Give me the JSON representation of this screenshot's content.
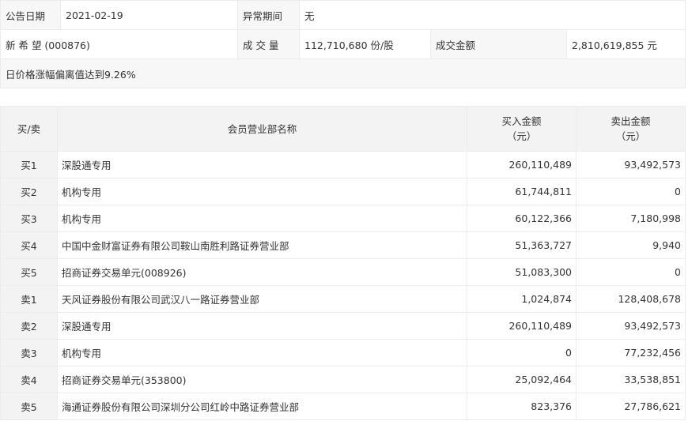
{
  "info": {
    "date_label": "公告日期",
    "date_value": "2021-02-19",
    "period_label": "异常期间",
    "period_value": "无",
    "stock": "新 希 望 (000876)",
    "volume_label": "成 交 量",
    "volume_value": "112,710,680 份/股",
    "amount_label": "成交金额",
    "amount_value": "2,810,619,855 元",
    "reason": "日价格涨幅偏离值达到9.26%"
  },
  "table": {
    "headers": {
      "side": "买/卖",
      "dept": "会员营业部名称",
      "buy_line1": "买入金额",
      "buy_line2": "（元）",
      "sell_line1": "卖出金额",
      "sell_line2": "（元）"
    },
    "rows": [
      {
        "side": "买1",
        "name": "深股通专用",
        "buy": "260,110,489",
        "sell": "93,492,573"
      },
      {
        "side": "买2",
        "name": "机构专用",
        "buy": "61,744,811",
        "sell": "0"
      },
      {
        "side": "买3",
        "name": "机构专用",
        "buy": "60,122,366",
        "sell": "7,180,998"
      },
      {
        "side": "买4",
        "name": "中国中金财富证券有限公司鞍山南胜利路证券营业部",
        "buy": "51,363,727",
        "sell": "9,940"
      },
      {
        "side": "买5",
        "name": "招商证券交易单元(008926)",
        "buy": "51,083,300",
        "sell": "0"
      },
      {
        "side": "卖1",
        "name": "天风证券股份有限公司武汉八一路证券营业部",
        "buy": "1,024,874",
        "sell": "128,408,678"
      },
      {
        "side": "卖2",
        "name": "深股通专用",
        "buy": "260,110,489",
        "sell": "93,492,573"
      },
      {
        "side": "卖3",
        "name": "机构专用",
        "buy": "0",
        "sell": "77,232,456"
      },
      {
        "side": "卖4",
        "name": "招商证券交易单元(353800)",
        "buy": "25,092,464",
        "sell": "33,538,851"
      },
      {
        "side": "卖5",
        "name": "海通证券股份有限公司深圳分公司红岭中路证券营业部",
        "buy": "823,376",
        "sell": "27,786,621"
      }
    ]
  }
}
